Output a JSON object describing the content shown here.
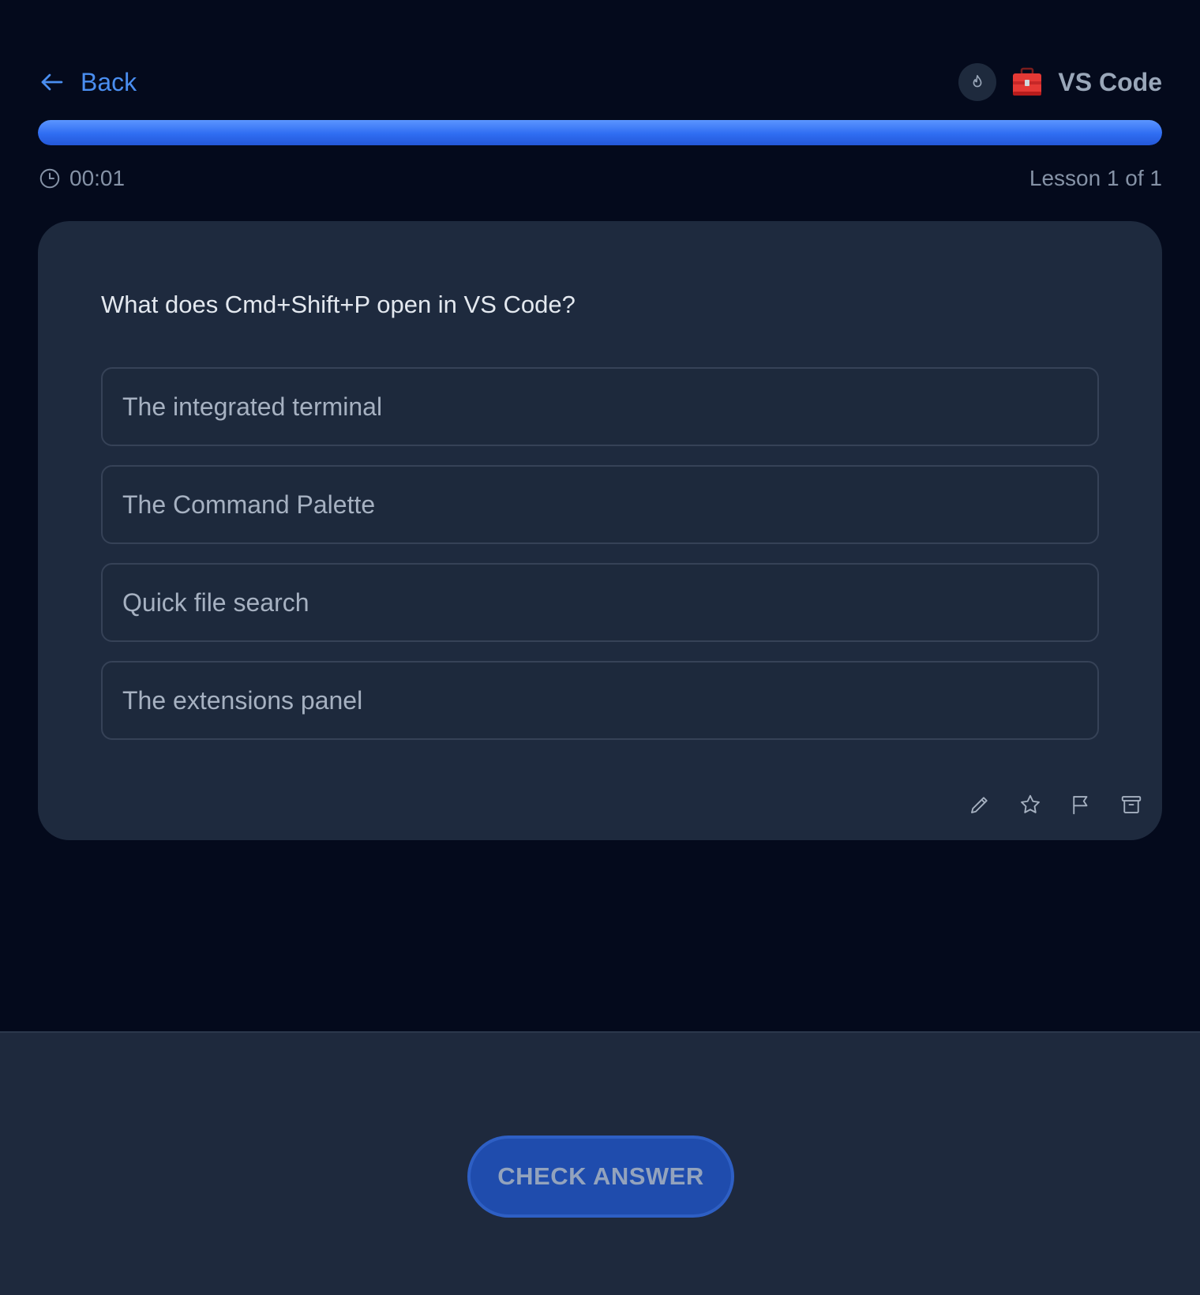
{
  "header": {
    "back_label": "Back",
    "course_title": "VS Code",
    "icons": {
      "back": "arrow-left-icon",
      "streak": "flame-icon",
      "course": "toolbox-icon"
    }
  },
  "progress": {
    "fraction": 1.0
  },
  "meta": {
    "timer": "00:01",
    "lesson_counter": "Lesson 1 of 1"
  },
  "question": {
    "text": "What does Cmd+Shift+P open in VS Code?",
    "options": [
      "The integrated terminal",
      "The Command Palette",
      "Quick file search",
      "The extensions panel"
    ]
  },
  "card_actions": [
    "pencil-icon",
    "star-icon",
    "flag-icon",
    "archive-icon"
  ],
  "footer": {
    "check_label": "CHECK ANSWER"
  },
  "colors": {
    "background": "#040a1c",
    "card": "#1e2a3e",
    "accent": "#4a8ef0",
    "progress": "#2f6df2",
    "button": "#1f4cad"
  }
}
